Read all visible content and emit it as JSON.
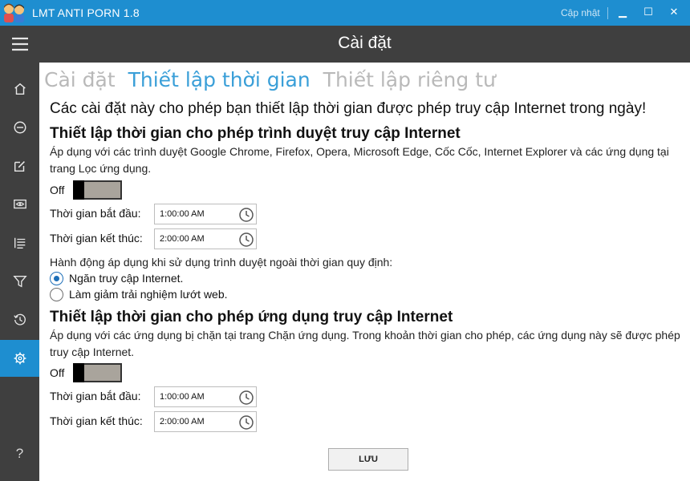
{
  "titlebar": {
    "app_title": "LMT ANTI PORN 1.8",
    "update_label": "Cập nhật",
    "min_symbol": "▁",
    "max_symbol": "☐",
    "close_symbol": "✕"
  },
  "colors": {
    "accent": "#1e8ed0",
    "sidebar": "#3f3f3f",
    "tab_active": "#3a9fd8",
    "tab_inactive": "#b9b9b9"
  },
  "sidebar": {
    "items": [
      {
        "icon": "menu-icon"
      },
      {
        "icon": "home-icon"
      },
      {
        "icon": "block-icon"
      },
      {
        "icon": "edit-icon"
      },
      {
        "icon": "screen-eye-icon"
      },
      {
        "icon": "list-icon"
      },
      {
        "icon": "filter-icon"
      },
      {
        "icon": "history-icon"
      },
      {
        "icon": "settings-icon",
        "active": true
      }
    ],
    "help_label": "?"
  },
  "header": {
    "title": "Cài đặt"
  },
  "tabs": [
    {
      "label": "Cài đặt",
      "active": false
    },
    {
      "label": "Thiết lập thời gian",
      "active": true
    },
    {
      "label": "Thiết lập riêng tư",
      "active": false
    }
  ],
  "intro": "Các cài đặt này cho phép bạn thiết lập thời gian được phép truy cập Internet trong ngày!",
  "browser_section": {
    "title": "Thiết lập thời gian cho phép trình duyệt truy cập Internet",
    "description": "Áp dụng với các trình duyệt Google Chrome, Firefox, Opera, Microsoft Edge, Cốc Cốc, Internet Explorer và các ứng dụng tại trang Lọc ứng dụng.",
    "toggle_label": "Off",
    "start_label": "Thời gian bắt đầu:",
    "start_value": "1:00:00 AM",
    "end_label": "Thời gian kết thúc:",
    "end_value": "2:00:00 AM",
    "action_label": "Hành động áp dụng khi sử dụng trình duyệt ngoài thời gian quy định:",
    "options": [
      {
        "label": "Ngăn truy cập Internet.",
        "checked": true
      },
      {
        "label": "Làm giảm trải nghiệm lướt web.",
        "checked": false
      }
    ]
  },
  "app_section": {
    "title": "Thiết lập thời gian cho phép ứng dụng truy cập Internet",
    "description": "Áp dụng với các ứng dụng bị chặn tại trang Chặn ứng dụng. Trong khoản thời gian cho phép, các ứng dụng này sẽ được phép truy cập Internet.",
    "toggle_label": "Off",
    "start_label": "Thời gian bắt đầu:",
    "start_value": "1:00:00 AM",
    "end_label": "Thời gian kết thúc:",
    "end_value": "2:00:00 AM"
  },
  "save_label": "LƯU"
}
